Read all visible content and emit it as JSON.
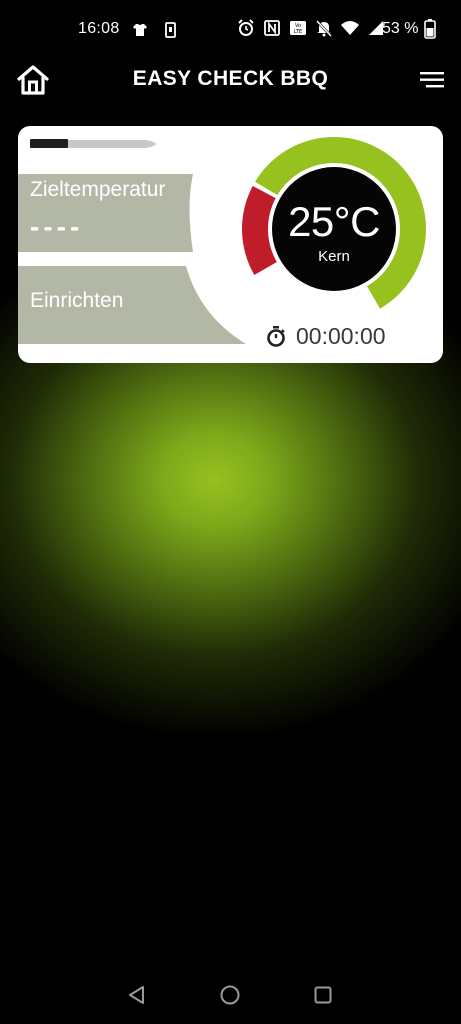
{
  "status_bar": {
    "time": "16:08",
    "battery_percent": "53 %",
    "icons": [
      "tshirt-icon",
      "sim-icon",
      "alarm-icon",
      "nfc-icon",
      "volte-icon",
      "mute-icon",
      "wifi-icon",
      "signal-icon",
      "battery-icon"
    ]
  },
  "app_bar": {
    "title": "EASY CHECK BBQ",
    "left_icon": "home-icon",
    "right_icon": "menu-icon"
  },
  "probe_card": {
    "target_label": "Zieltemperatur",
    "target_value": "----",
    "setup_label": "Einrichten",
    "temperature": "25°C",
    "temperature_label": "Kern",
    "timer": "00:00:00",
    "timer_icon": "stopwatch-icon",
    "gauge_red_fraction": 0.15,
    "gauge_green_fraction": 0.6
  },
  "colors": {
    "accent_green": "#96c11f",
    "alert_red": "#c01d2a",
    "tab_grey": "#b3b8a6",
    "card_white": "#ffffff"
  },
  "nav_bar": {
    "icons": [
      "back-icon",
      "home-circle-icon",
      "recents-icon"
    ]
  }
}
